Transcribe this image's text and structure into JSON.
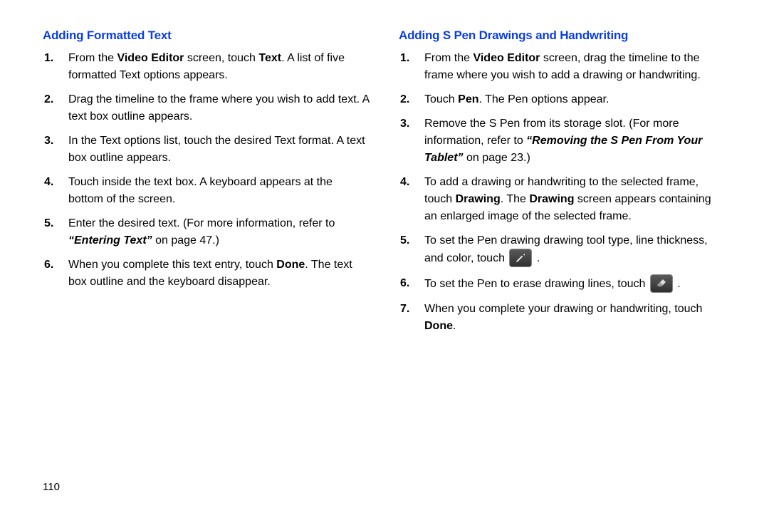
{
  "left": {
    "heading": "Adding Formatted Text",
    "items": [
      {
        "pre": "From the ",
        "b1": "Video Editor",
        "mid1": " screen, touch ",
        "b2": "Text",
        "post": ". A list of five formatted Text options appears."
      },
      {
        "text": "Drag the timeline to the frame where you wish to add text. A text box outline appears."
      },
      {
        "text": "In the Text options list, touch the desired Text format. A text box outline appears."
      },
      {
        "text": "Touch inside the text box. A keyboard appears at the bottom of the screen."
      },
      {
        "pre": "Enter the desired text. (For more information, refer to ",
        "ref": "“Entering Text”",
        "post": " on page 47.)"
      },
      {
        "pre": "When you complete this text entry, touch ",
        "b1": "Done",
        "post": ". The text box outline and the keyboard disappear."
      }
    ]
  },
  "right": {
    "heading": "Adding S Pen Drawings and Handwriting",
    "items": [
      {
        "pre": "From the ",
        "b1": "Video Editor",
        "post": " screen, drag the timeline to the frame where you wish to add a drawing or handwriting."
      },
      {
        "pre": "Touch ",
        "b1": "Pen",
        "post": ". The Pen options appear."
      },
      {
        "pre": "Remove the S Pen from its storage slot. (For more information, refer to ",
        "ref": "“Removing the S Pen From Your Tablet”",
        "post": " on page 23.)"
      },
      {
        "pre": "To add a drawing or handwriting to the selected frame, touch ",
        "b1": "Drawing",
        "mid1": ". The ",
        "b2": "Drawing",
        "post": " screen appears containing an enlarged image of the selected frame."
      },
      {
        "pre": "To set the Pen drawing drawing tool type, line thickness, and color, touch ",
        "icon": "pen-icon",
        "post": " ."
      },
      {
        "pre": "To set the Pen to erase drawing lines, touch ",
        "icon": "eraser-icon",
        "post": " ."
      },
      {
        "pre": "When you complete your drawing or handwriting, touch ",
        "b1": "Done",
        "post": "."
      }
    ]
  },
  "page_number": "110"
}
